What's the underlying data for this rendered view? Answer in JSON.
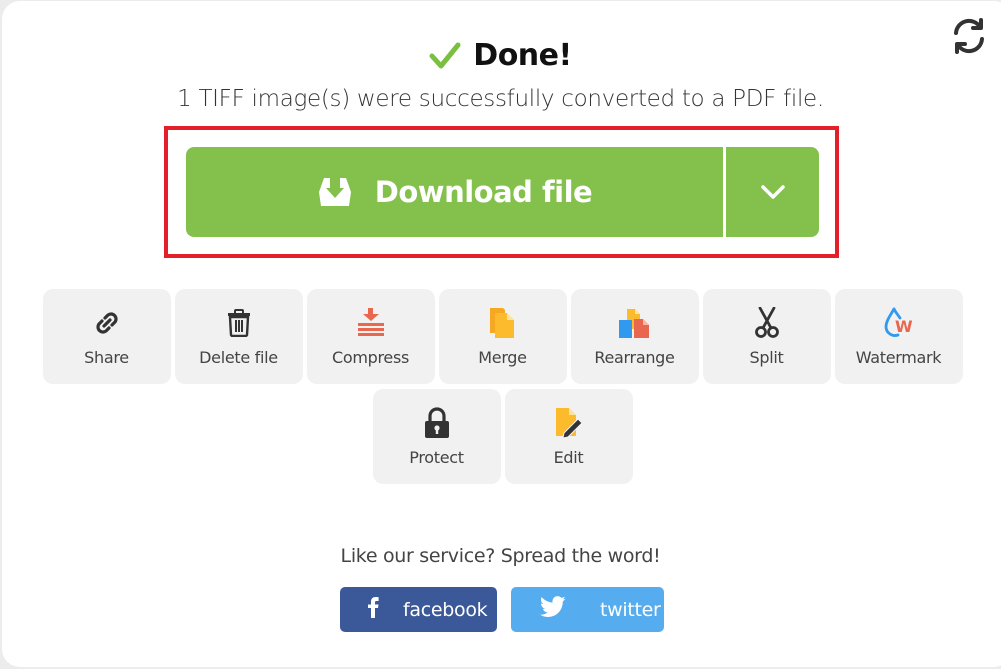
{
  "header": {
    "status_title": "Done!",
    "status_icon": "check-icon",
    "message": "1 TIFF image(s) were successfully converted to a PDF file.",
    "refresh_icon": "refresh-icon"
  },
  "download": {
    "label": "Download file",
    "icon": "download-tray-icon",
    "toggle_icon": "chevron-down-icon"
  },
  "tools": [
    {
      "label": "Share",
      "icon": "link-icon"
    },
    {
      "label": "Delete file",
      "icon": "trash-icon"
    },
    {
      "label": "Compress",
      "icon": "compress-icon"
    },
    {
      "label": "Merge",
      "icon": "merge-icon"
    },
    {
      "label": "Rearrange",
      "icon": "rearrange-icon"
    },
    {
      "label": "Split",
      "icon": "scissors-icon"
    },
    {
      "label": "Watermark",
      "icon": "watermark-icon"
    },
    {
      "label": "Protect",
      "icon": "lock-icon"
    },
    {
      "label": "Edit",
      "icon": "edit-file-icon"
    }
  ],
  "share": {
    "prompt": "Like our service? Spread the word!",
    "facebook_label": "facebook",
    "twitter_label": "twitter"
  },
  "colors": {
    "accent_green": "#84c14c",
    "highlight_red": "#e3202a",
    "facebook_blue": "#3b5998",
    "twitter_blue": "#55acee"
  }
}
